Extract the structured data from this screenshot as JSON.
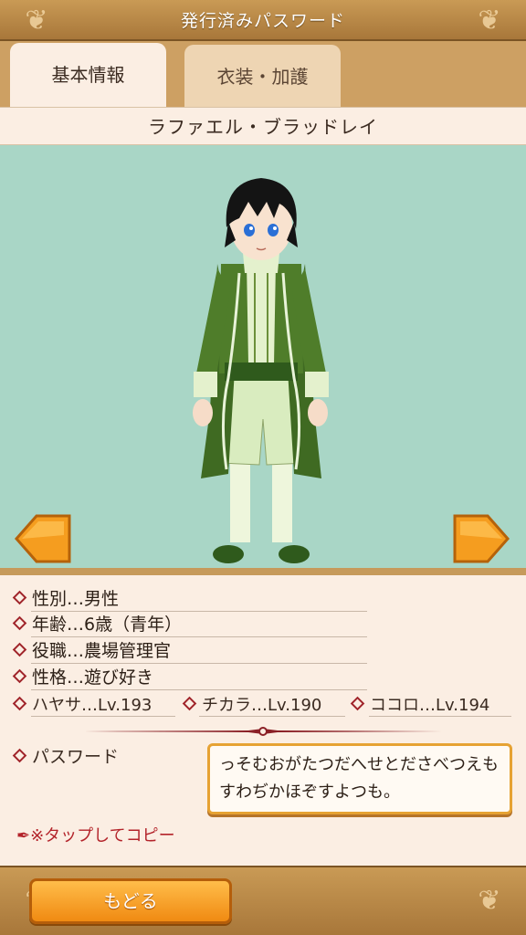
{
  "header": {
    "title": "発行済みパスワード"
  },
  "tabs": [
    {
      "label": "基本情報",
      "active": true
    },
    {
      "label": "衣装・加護",
      "active": false
    }
  ],
  "character": {
    "name": "ラファエル・ブラッドレイ"
  },
  "info": {
    "gender": "性別…男性",
    "age": "年齢…6歳（青年）",
    "role": "役職…農場管理官",
    "personality": "性格…遊び好き"
  },
  "stats": [
    {
      "label": "ハヤサ…Lv.193"
    },
    {
      "label": "チカラ…Lv.190"
    },
    {
      "label": "ココロ…Lv.194"
    }
  ],
  "password": {
    "label": "パスワード",
    "value": "っそむおがたつだへせとださべつえもすわぢかほぞすよつも。"
  },
  "copy_hint": "※タップしてコピー",
  "footer": {
    "back_label": "もどる"
  },
  "colors": {
    "header_brown": "#b98a48",
    "viewer_bg": "#a9d6c6",
    "accent_orange": "#f5a023",
    "diamond_red": "#a0242a"
  }
}
